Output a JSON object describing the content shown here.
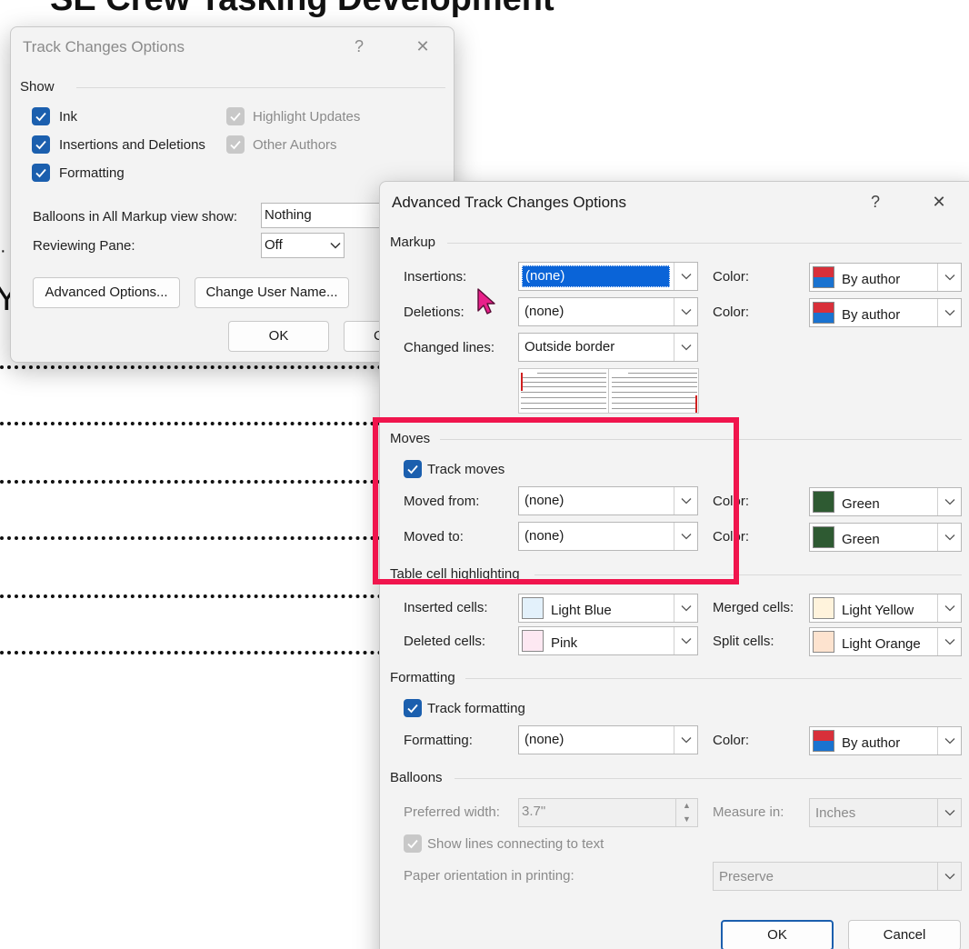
{
  "document": {
    "title": "SE Crew Tasking Development",
    "fragment": "Y"
  },
  "track_changes_dialog": {
    "title": "Track Changes Options",
    "help_glyph": "?",
    "close_glyph": "✕",
    "show_group": "Show",
    "checkboxes": {
      "ink": "Ink",
      "insertions_deletions": "Insertions and Deletions",
      "formatting": "Formatting",
      "highlight_updates": "Highlight Updates",
      "other_authors": "Other Authors"
    },
    "balloons_label": "Balloons in All Markup view show:",
    "balloons_value": "Nothing",
    "reviewing_pane_label": "Reviewing Pane:",
    "reviewing_pane_value": "Off",
    "advanced_button": "Advanced Options...",
    "change_user_button": "Change User Name...",
    "ok_button": "OK",
    "cancel_button_partial": "C"
  },
  "advanced_dialog": {
    "title": "Advanced Track Changes Options",
    "help_glyph": "?",
    "close_glyph": "✕",
    "markup": {
      "group": "Markup",
      "insertions_label": "Insertions:",
      "insertions_value": "(none)",
      "deletions_label": "Deletions:",
      "deletions_value": "(none)",
      "changed_lines_label": "Changed lines:",
      "changed_lines_value": "Outside border",
      "color_label": "Color:",
      "insert_color": "By author",
      "delete_color": "By author"
    },
    "moves": {
      "group": "Moves",
      "track_moves": "Track moves",
      "moved_from_label": "Moved from:",
      "moved_from_value": "(none)",
      "moved_to_label": "Moved to:",
      "moved_to_value": "(none)",
      "color_label": "Color:",
      "from_color": "Green",
      "to_color": "Green"
    },
    "table": {
      "group": "Table cell highlighting",
      "inserted_label": "Inserted cells:",
      "inserted_value": "Light Blue",
      "deleted_label": "Deleted cells:",
      "deleted_value": "Pink",
      "merged_label": "Merged cells:",
      "merged_value": "Light Yellow",
      "split_label": "Split cells:",
      "split_value": "Light Orange"
    },
    "formatting": {
      "group": "Formatting",
      "track_formatting": "Track formatting",
      "formatting_label": "Formatting:",
      "formatting_value": "(none)",
      "color_label": "Color:",
      "color_value": "By author"
    },
    "balloons": {
      "group": "Balloons",
      "preferred_width_label": "Preferred width:",
      "preferred_width_value": "3.7\"",
      "measure_in_label": "Measure in:",
      "measure_in_value": "Inches",
      "show_lines": "Show lines connecting to text",
      "paper_orientation_label": "Paper orientation in printing:",
      "paper_orientation_value": "Preserve"
    },
    "ok_button": "OK",
    "cancel_button": "Cancel"
  },
  "colors": {
    "accent": "#1b5fae",
    "selection": "#0a64d8",
    "highlight_box": "#f0154d",
    "by_author_top": "#d8303a",
    "by_author_bottom": "#1a73d0",
    "green": "#2e5a32",
    "light_blue": "#e3f1fb",
    "pink": "#fde8f2",
    "light_yellow": "#fff3dc",
    "light_orange": "#fde3cf"
  },
  "icons": {
    "checkmark": "checkmark-icon",
    "chevron": "chevron-down-icon",
    "cursor": "mouse-pointer-icon"
  }
}
